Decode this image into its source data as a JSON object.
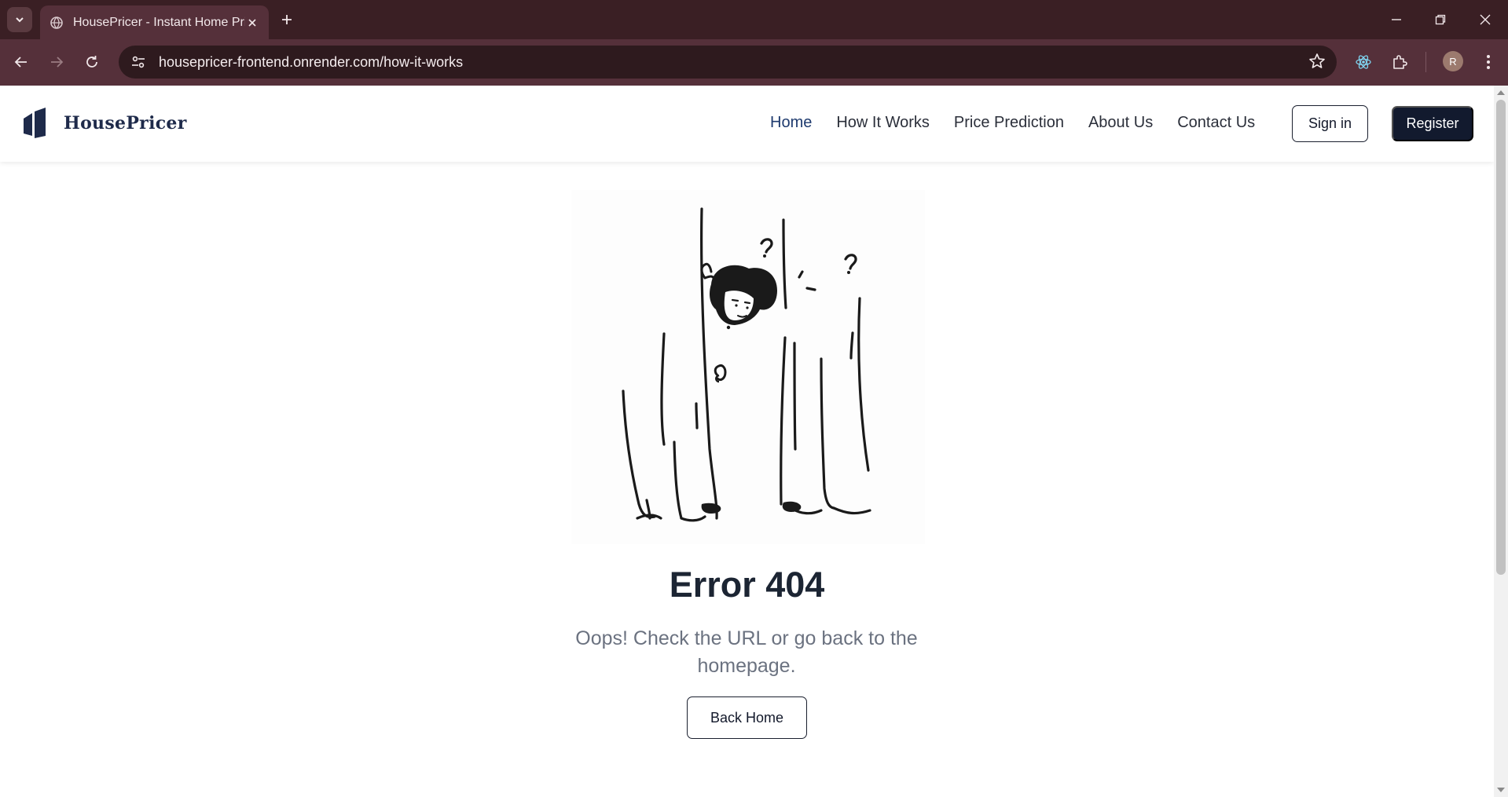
{
  "browser": {
    "tab_title": "HousePricer - Instant Home Pric",
    "url": "housepricer-frontend.onrender.com/how-it-works",
    "profile_initial": "R"
  },
  "header": {
    "brand": "HousePricer",
    "nav": [
      {
        "label": "Home",
        "active": true
      },
      {
        "label": "How It Works",
        "active": false
      },
      {
        "label": "Price Prediction",
        "active": false
      },
      {
        "label": "About Us",
        "active": false
      },
      {
        "label": "Contact Us",
        "active": false
      }
    ],
    "signin_label": "Sign in",
    "register_label": "Register"
  },
  "error": {
    "title": "Error 404",
    "message": "Oops! Check the URL or go back to the homepage.",
    "back_label": "Back Home"
  },
  "colors": {
    "chrome_tabbar": "#3a1f24",
    "chrome_toolbar": "#55303a",
    "brand_navy": "#1e2a4a",
    "register_bg": "#121a2e",
    "nav_active": "#1e3a6e"
  }
}
